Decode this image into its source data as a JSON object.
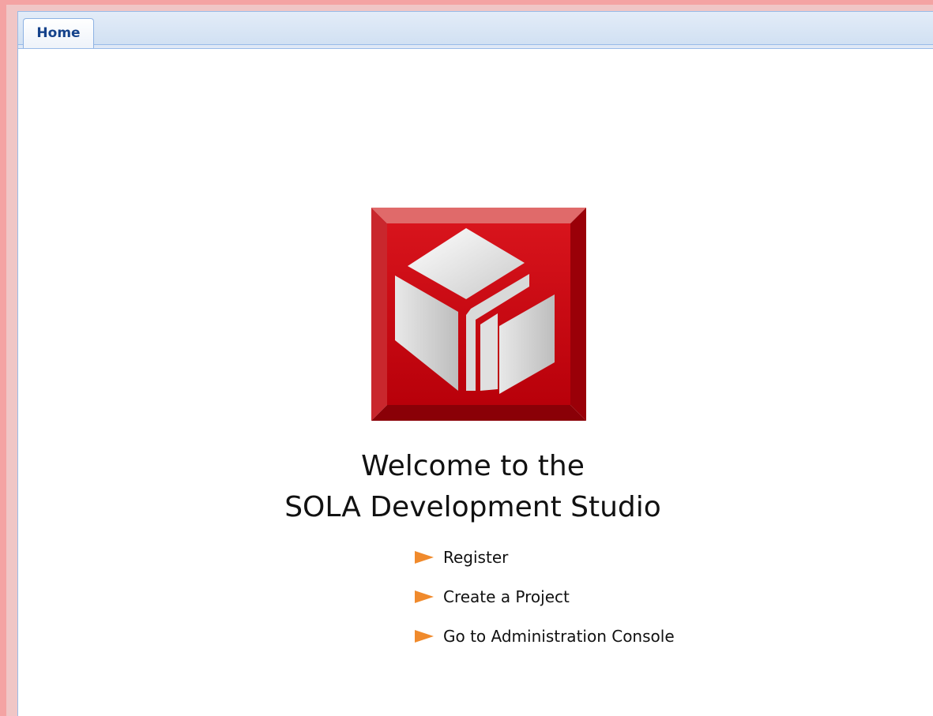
{
  "tabs": [
    {
      "label": "Home",
      "active": true
    }
  ],
  "welcome": {
    "line1": "Welcome to the",
    "line2": "SOLA Development Studio"
  },
  "links": [
    {
      "label": "Register",
      "icon": "orange-arrow-icon"
    },
    {
      "label": "Create a Project",
      "icon": "orange-arrow-icon"
    },
    {
      "label": "Go to Administration Console",
      "icon": "orange-arrow-icon"
    }
  ],
  "colors": {
    "accent_arrow": "#f08a2c",
    "logo_red": "#c0000a",
    "tab_text": "#15428b",
    "frame_border": "#f4a3a3"
  },
  "logo": {
    "icon": "sola-cube-logo-icon"
  }
}
